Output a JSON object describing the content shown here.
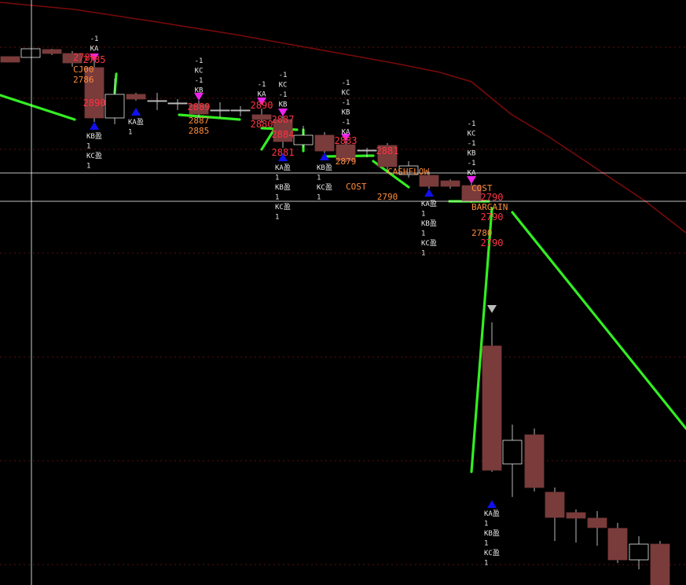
{
  "chart_data": {
    "type": "candlestick",
    "colors": {
      "background": "#000000",
      "bear_body": "#7a3b3b",
      "bull_body": "#000000",
      "bull_border": "#e8e8e8",
      "wick": "#e8e8e8",
      "ma_line": "#7a0a0a",
      "trend_line": "#33ee22",
      "cursor_line": "#ffffff",
      "label_red": "#ff3344",
      "label_orange": "#ff8c3a",
      "marker_up": "#1010ee",
      "marker_down": "#ee22ee",
      "marker_grey": "#bbbbbb"
    },
    "labels_red": [
      "2785",
      "2890",
      "2889",
      "2890",
      "2887",
      "2884",
      "2883",
      "2881",
      "2790",
      "2790",
      "2790",
      "2880",
      "2881",
      "2786"
    ],
    "labels_orange": [
      "CJ00",
      "2786",
      "2887",
      "2885",
      "2879",
      "2790",
      "2780",
      "COST",
      "COST",
      "CASHFLOW",
      "BARGAIN"
    ],
    "signal_blocks": [
      {
        "lines": [
          "-1",
          "KA"
        ]
      },
      {
        "lines": [
          "-1",
          "KC",
          "-1",
          "KB"
        ]
      },
      {
        "lines": [
          "-1",
          "KA"
        ]
      },
      {
        "lines": [
          "-1",
          "KC",
          "-1",
          "KB"
        ]
      },
      {
        "lines": [
          "-1",
          "KC",
          "-1",
          "KB",
          "-1",
          "KA"
        ]
      },
      {
        "lines": [
          "-1",
          "KC",
          "-1",
          "KB",
          "-1",
          "KA"
        ]
      },
      {
        "lines": [
          "KB盈",
          "1",
          "KC盈",
          "1"
        ]
      },
      {
        "lines": [
          "KA盈",
          "1"
        ]
      },
      {
        "lines": [
          "KA盈",
          "1",
          "KB盈",
          "1",
          "KC盈",
          "1"
        ]
      },
      {
        "lines": [
          "KB盈",
          "1",
          "KC盈",
          "1"
        ]
      },
      {
        "lines": [
          "KA盈",
          "1",
          "KB盈",
          "1",
          "KC盈",
          "1"
        ]
      },
      {
        "lines": [
          "KA盈",
          "1",
          "KB盈",
          "1",
          "KC盈",
          "1"
        ]
      }
    ]
  }
}
